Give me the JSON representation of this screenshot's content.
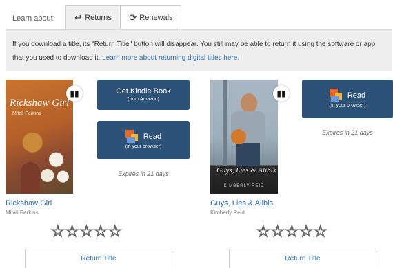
{
  "learn": {
    "label": "Learn about:",
    "tabs": [
      {
        "label": "Returns",
        "icon": "return-arrow-icon",
        "active": true
      },
      {
        "label": "Renewals",
        "icon": "refresh-icon",
        "active": false
      }
    ]
  },
  "notice": {
    "text": "If you download a title, its \"Return Title\" button will disappear. You still may be able to return it using the software or app that you used to download it.",
    "link": "Learn more about returning digital titles here."
  },
  "books": [
    {
      "title": "Rickshaw Girl",
      "author": "Mitali Perkins",
      "cover_title": "Rickshaw Girl",
      "cover_author": "Mitali Perkins",
      "kindle_button": {
        "label": "Get Kindle Book",
        "sub": "(from Amazon)"
      },
      "read_button": {
        "label": "Read",
        "sub": "(in your browser)"
      },
      "expires": "Expires in 21 days",
      "rating": "☆☆☆☆☆",
      "return_label": "Return Title"
    },
    {
      "title": "Guys, Lies & Alibis",
      "author": "Kimberly Reid",
      "cover_title": "Guys, Lies & Alibis",
      "cover_author": "KIMBERLY REID",
      "read_button": {
        "label": "Read",
        "sub": "(in your browser)"
      },
      "expires": "Expires in 21 days",
      "rating": "☆☆☆☆☆",
      "return_label": "Return Title"
    }
  ],
  "colors": {
    "button_bg": "#2d5277",
    "link": "#2a6cb0",
    "notice_bg": "#eeeeee"
  }
}
